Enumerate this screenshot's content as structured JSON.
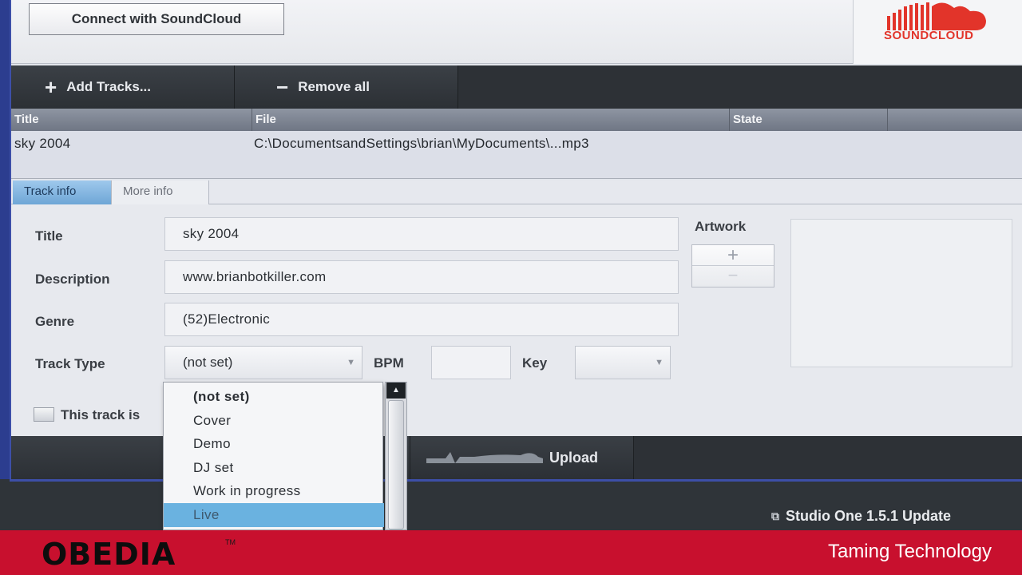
{
  "connect": {
    "label": "Connect with SoundCloud"
  },
  "brand": {
    "word": "SOUNDCLOUD",
    "color": "#e2342a",
    "icon": "soundcloud-cloud-icon"
  },
  "toolbar": {
    "add_label": "Add Tracks...",
    "add_icon": "plus-icon",
    "remove_label": "Remove all",
    "remove_icon": "minus-icon"
  },
  "table": {
    "columns": [
      "Title",
      "File",
      "State"
    ],
    "rows": [
      {
        "title": "sky 2004",
        "file": "C:\\DocumentsandSettings\\brian\\MyDocuments\\...mp3",
        "state": ""
      }
    ]
  },
  "tabs": [
    {
      "label": "Track info",
      "active": true
    },
    {
      "label": "More info",
      "active": false
    }
  ],
  "form": {
    "title_label": "Title",
    "title_value": "sky 2004",
    "description_label": "Description",
    "description_value": "www.brianbotkiller.com",
    "genre_label": "Genre",
    "genre_value": "(52)Electronic",
    "track_type_label": "Track Type",
    "track_type_value": "(not set)",
    "bpm_label": "BPM",
    "bpm_value": "",
    "key_label": "Key",
    "key_value": "",
    "artwork_label": "Artwork",
    "checkbox_label": "This track is"
  },
  "dropdown": {
    "options": [
      "(not set)",
      "Cover",
      "Demo",
      "DJ set",
      "Work in progress",
      "Live"
    ],
    "highlighted": "Live"
  },
  "upload": {
    "label": "Upload"
  },
  "status": {
    "update_text": "Studio One 1.5.1 Update"
  },
  "banner": {
    "logo": "OBEDIA",
    "tm": "TM",
    "tagline": "Taming Technology",
    "color": "#c8102e"
  }
}
